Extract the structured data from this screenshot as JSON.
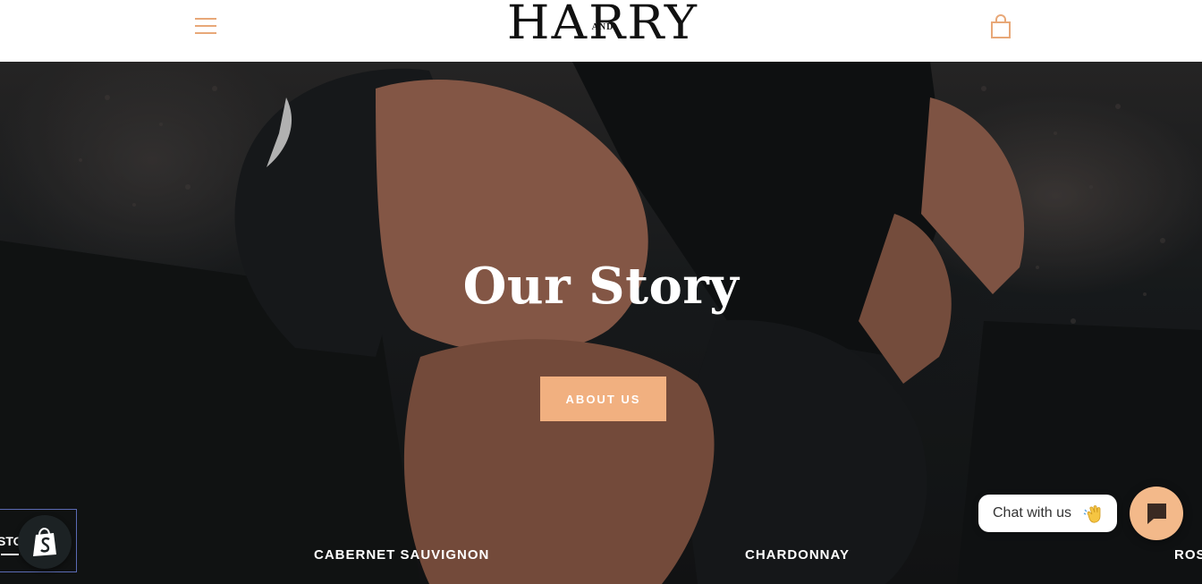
{
  "header": {
    "logo_main": "HARRY",
    "logo_and": "AND",
    "menu_icon": "hamburger-menu-icon",
    "cart_icon": "shopping-bag-icon"
  },
  "hero": {
    "title": "Our Story",
    "button_label": "ABOUT US"
  },
  "collections": [
    {
      "label": "CABERNET SAUVIGNON"
    },
    {
      "label": "CHARDONNAY"
    },
    {
      "label": "ROS"
    }
  ],
  "shop_box": {
    "partial_label": "STO"
  },
  "chat": {
    "bubble_text": "Chat with us",
    "wave_icon": "waving-hand-icon",
    "button_icon": "chat-icon"
  },
  "colors": {
    "accent": "#f1b080",
    "header_icon": "#e8a878",
    "chat_button": "#f3b98a"
  }
}
